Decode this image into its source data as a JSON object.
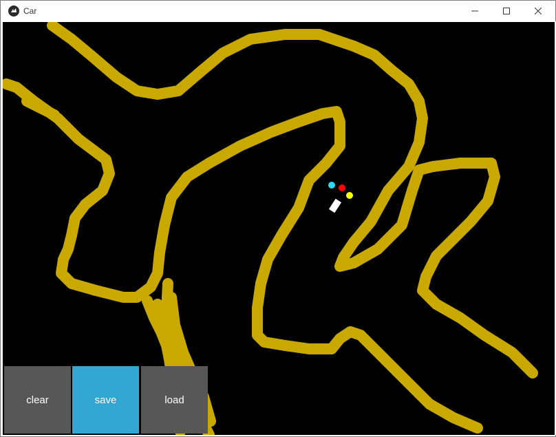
{
  "window": {
    "title": "Car",
    "icon": "kivy-logo-icon",
    "controls": {
      "minimize_icon": "minimize-icon",
      "maximize_icon": "maximize-icon",
      "close_icon": "close-icon"
    }
  },
  "canvas": {
    "background": "#000000",
    "stroke_color": "#c9a800",
    "car": {
      "body_color": "#ffffff",
      "sensors": [
        {
          "name": "sensor-left",
          "color": "#29d9f0"
        },
        {
          "name": "sensor-center",
          "color": "#ff0000"
        },
        {
          "name": "sensor-right",
          "color": "#ffff00"
        }
      ]
    }
  },
  "buttons": {
    "clear_label": "clear",
    "save_label": "save",
    "load_label": "load",
    "gray_color": "#575757",
    "accent_color": "#33a6d1"
  }
}
